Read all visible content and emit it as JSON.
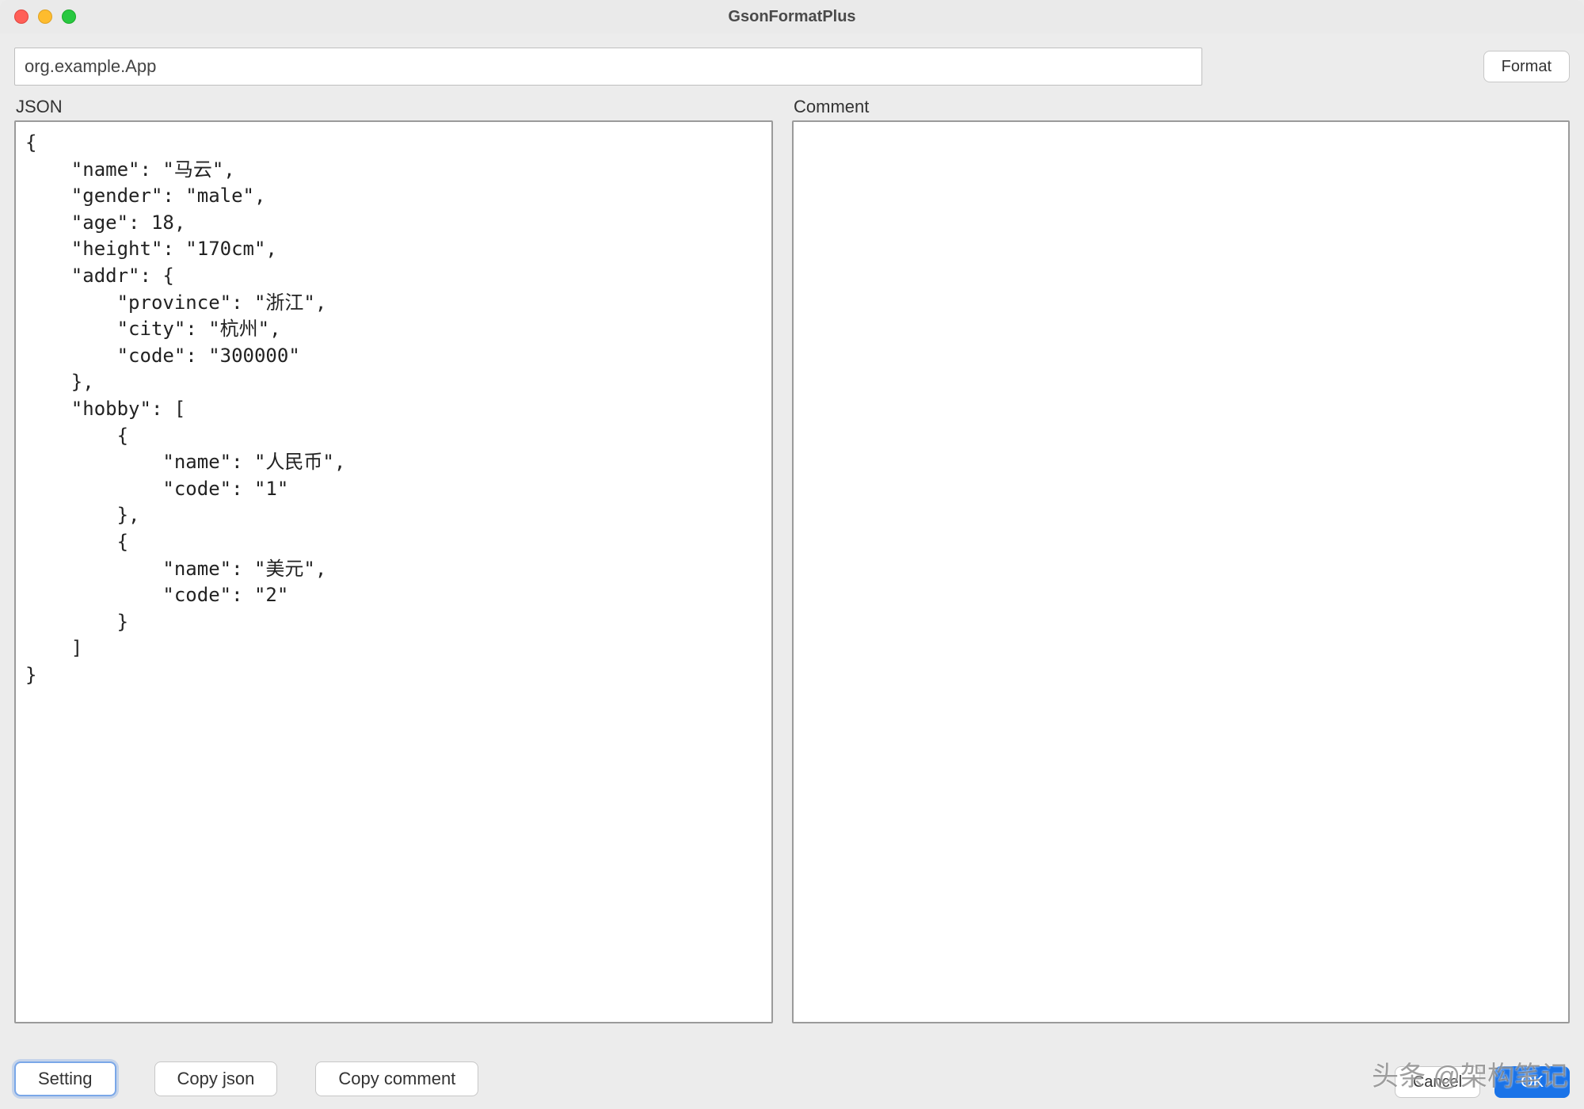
{
  "window": {
    "title": "GsonFormatPlus"
  },
  "toprow": {
    "classname_value": "org.example.App",
    "format_label": "Format"
  },
  "labels": {
    "json": "JSON",
    "comment": "Comment"
  },
  "editors": {
    "json_text": "{\n    \"name\": \"马云\",\n    \"gender\": \"male\",\n    \"age\": 18,\n    \"height\": \"170cm\",\n    \"addr\": {\n        \"province\": \"浙江\",\n        \"city\": \"杭州\",\n        \"code\": \"300000\"\n    },\n    \"hobby\": [\n        {\n            \"name\": \"人民币\",\n            \"code\": \"1\"\n        },\n        {\n            \"name\": \"美元\",\n            \"code\": \"2\"\n        }\n    ]\n}",
    "comment_text": ""
  },
  "bottom": {
    "setting_label": "Setting",
    "copy_json_label": "Copy  json",
    "copy_comment_label": "Copy comment",
    "cancel_label": "Cancel",
    "ok_label": "OK"
  },
  "watermark": "头条 @架构笔记"
}
